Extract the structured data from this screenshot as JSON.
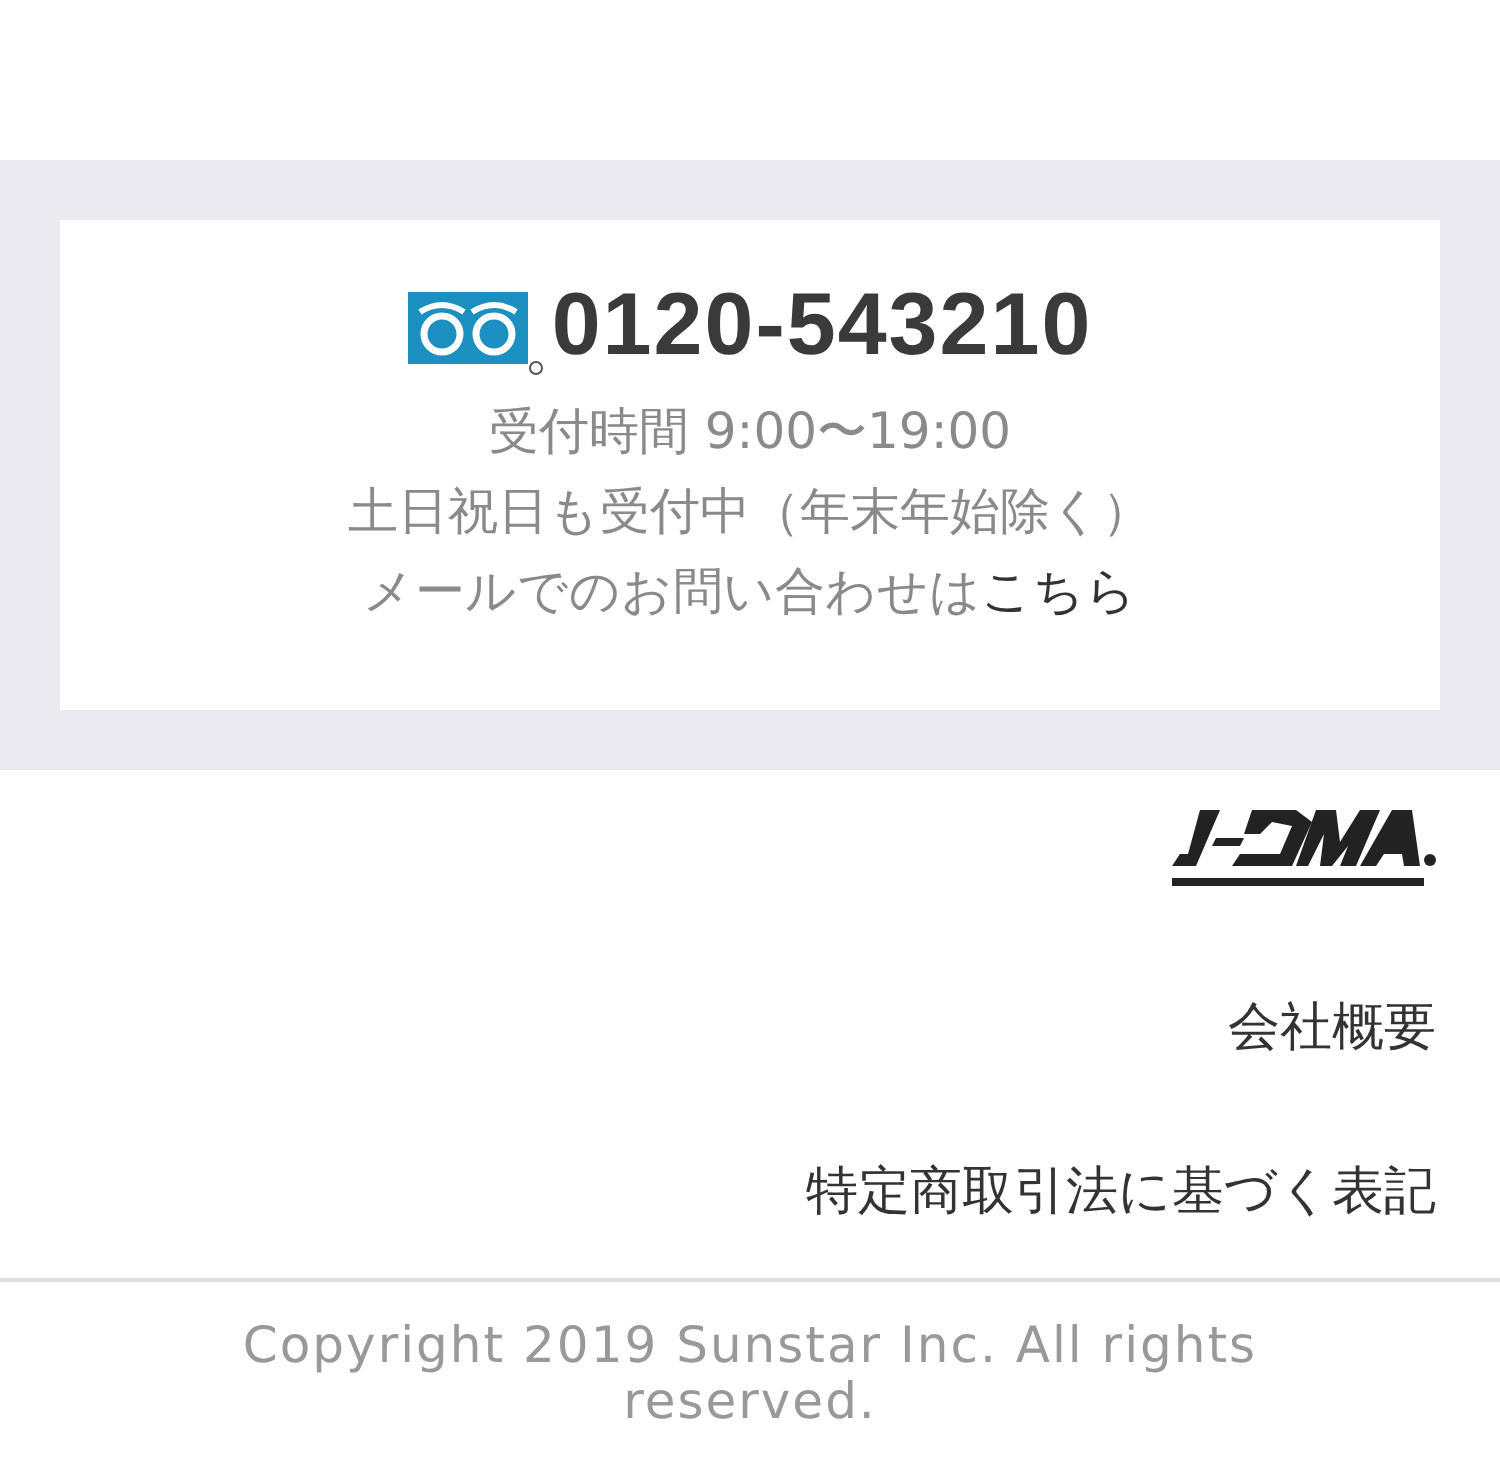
{
  "contact": {
    "phone": "0120-543210",
    "hours": "受付時間 9:00〜19:00",
    "days": "土日祝日も受付中（年末年始除く）",
    "mail_text": "メールでのお問い合わせは",
    "mail_link": "こちら"
  },
  "links": [
    "会社概要",
    "特定商取引法に基づく表記"
  ],
  "copyright": "Copyright 2019 Sunstar Inc. All rights reserved."
}
